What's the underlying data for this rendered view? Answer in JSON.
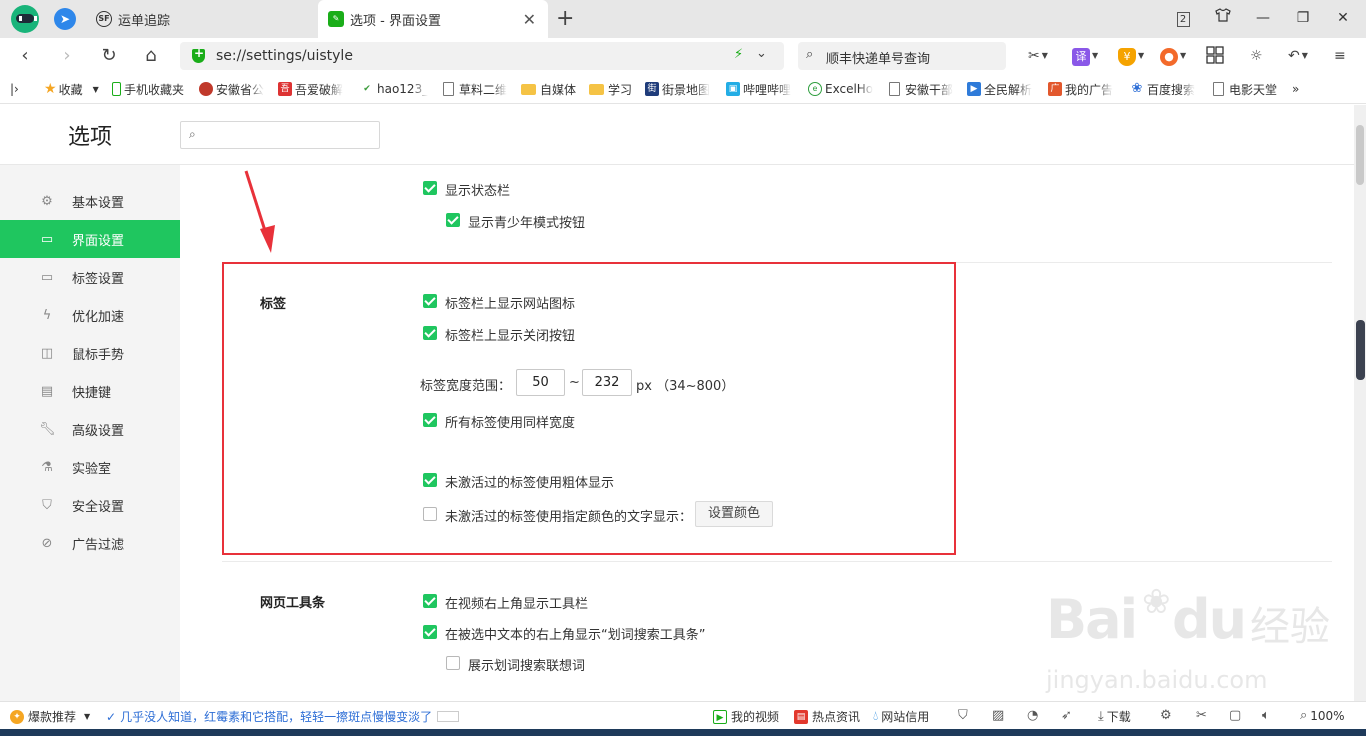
{
  "tabs": [
    {
      "title": "运单追踪",
      "favicon": "SF"
    },
    {
      "title": "选项 - 界面设置",
      "favicon": "✎"
    }
  ],
  "window": {
    "tab_count": "2"
  },
  "address_bar": {
    "url": "se://settings/uistyle"
  },
  "search_bar": {
    "text": "顺丰快递单号查询"
  },
  "toolbar_icons": {
    "translate": "译",
    "money": "¥"
  },
  "bookmarks": [
    {
      "label": "收藏",
      "icon": "star-icon"
    },
    {
      "label": "手机收藏夹",
      "icon": "phone-icon"
    },
    {
      "label": "安徽省公",
      "icon": "emblem-icon"
    },
    {
      "label": "吾爱破解",
      "icon": "wuai-icon"
    },
    {
      "label": "hao123_",
      "icon": "hao-icon"
    },
    {
      "label": "草料二维",
      "icon": "page-icon"
    },
    {
      "label": "自媒体",
      "icon": "folder-icon"
    },
    {
      "label": "学习",
      "icon": "folder-icon"
    },
    {
      "label": "街景地图",
      "icon": "street-icon"
    },
    {
      "label": "哔哩哔哩",
      "icon": "bilibili-icon"
    },
    {
      "label": "ExcelHo",
      "icon": "excel-icon"
    },
    {
      "label": "安徽干部",
      "icon": "page-icon"
    },
    {
      "label": "全民解析",
      "icon": "play-icon"
    },
    {
      "label": "我的广告",
      "icon": "ad-icon"
    },
    {
      "label": "百度搜索",
      "icon": "baidu-icon"
    },
    {
      "label": "电影天堂",
      "icon": "page-icon"
    }
  ],
  "settings": {
    "title": "选项",
    "search_placeholder": ""
  },
  "sidebar": {
    "items": [
      {
        "label": "基本设置",
        "icon": "gear-icon"
      },
      {
        "label": "界面设置",
        "icon": "window-icon"
      },
      {
        "label": "标签设置",
        "icon": "tab-icon"
      },
      {
        "label": "优化加速",
        "icon": "lightning-icon"
      },
      {
        "label": "鼠标手势",
        "icon": "mouse-icon"
      },
      {
        "label": "快捷键",
        "icon": "keyboard-icon"
      },
      {
        "label": "高级设置",
        "icon": "wrench-icon"
      },
      {
        "label": "实验室",
        "icon": "flask-icon"
      },
      {
        "label": "安全设置",
        "icon": "shield-icon"
      },
      {
        "label": "广告过滤",
        "icon": "block-icon"
      }
    ],
    "active": "界面设置"
  },
  "main": {
    "status_bar_section": {
      "show_status_bar": {
        "label": "显示状态栏",
        "checked": true
      },
      "show_youth_button": {
        "label": "显示青少年模式按钮",
        "checked": true
      }
    },
    "tabs_section": {
      "title": "标签",
      "show_site_icon": {
        "label": "标签栏上显示网站图标",
        "checked": true
      },
      "show_close_button": {
        "label": "标签栏上显示关闭按钮",
        "checked": true
      },
      "width_range_label": "标签宽度范围：",
      "width_min": "50",
      "width_sep": "~",
      "width_max": "232",
      "width_unit": "px （34~800）",
      "same_width": {
        "label": "所有标签使用同样宽度",
        "checked": true
      },
      "bold_inactive": {
        "label": "未激活过的标签使用粗体显示",
        "checked": true
      },
      "color_inactive": {
        "label": "未激活过的标签使用指定颜色的文字显示：",
        "checked": false
      },
      "set_color_button": "设置颜色"
    },
    "web_toolbar_section": {
      "title": "网页工具条",
      "video_toolbar": {
        "label": "在视频右上角显示工具栏",
        "checked": true
      },
      "word_search_toolbar": {
        "label": "在被选中文本的右上角显示“划词搜索工具条”",
        "checked": true
      },
      "word_suggest": {
        "label": "展示划词搜索联想词",
        "checked": false
      }
    }
  },
  "status_bar": {
    "promo": "爆款推荐",
    "news": "几乎没人知道，红霉素和它搭配，轻轻一擦斑点慢慢变淡了",
    "my_video": "我的视频",
    "hot_news": "热点资讯",
    "site_credit": "网站信用",
    "download": "下载",
    "zoom": "100%"
  },
  "colors": {
    "accent": "#1fc65f",
    "highlight": "#e8313a"
  }
}
